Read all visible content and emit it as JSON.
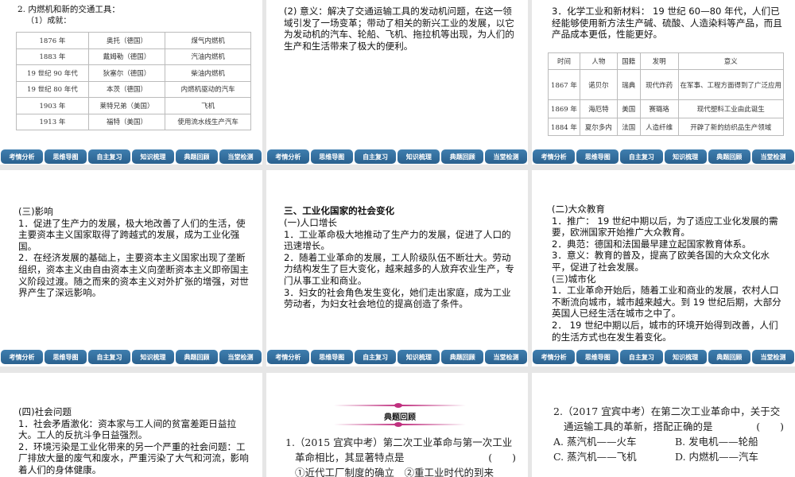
{
  "nav": [
    "考情分析",
    "思维导图",
    "自主复习",
    "知识梳理",
    "典题回顾",
    "当堂检测"
  ],
  "s1": {
    "title": "2. 内燃机和新的交通工具：",
    "sub": "（1）成就：",
    "rows": [
      [
        "1876 年",
        "奥托（德国）",
        "煤气内燃机"
      ],
      [
        "1883 年",
        "戴姆勒（德国）",
        "汽油内燃机"
      ],
      [
        "19 世纪 90 年代",
        "狄塞尔（德国）",
        "柴油内燃机"
      ],
      [
        "19 世纪 80 年代",
        "本茨（德国）",
        "内燃机驱动的汽车"
      ],
      [
        "1903 年",
        "莱特兄弟（美国）",
        "飞机"
      ],
      [
        "1913 年",
        "福特（美国）",
        "使用流水线生产汽车"
      ]
    ]
  },
  "s2": {
    "text": "(2) 意义：解决了交通运输工具的发动机问题，在这一领域引发了一场变革；带动了相关的新兴工业的发展，以它为发动机的汽车、轮船、飞机、拖拉机等出现，为人们的生产和生活带来了极大的便利。"
  },
  "s3": {
    "text": "3．化学工业和新材料： 19 世纪 60—80 年代，人们已经能够使用新方法生产碱、硫酸、人造染料等产品，而且产品成本更低，性能更好。",
    "header": [
      "时间",
      "人物",
      "国籍",
      "发明",
      "意义"
    ],
    "rows": [
      [
        "1867 年",
        "诺贝尔",
        "瑞典",
        "现代炸药",
        "在军事、工程方面得到了广泛应用"
      ],
      [
        "1869 年",
        "海厄特",
        "美国",
        "赛璐珞",
        "现代塑料工业由此诞生"
      ],
      [
        "1884 年",
        "夏尔多内",
        "法国",
        "人造纤维",
        "开辟了新的纺织品生产领域"
      ]
    ]
  },
  "s4": {
    "lines": [
      "(三)影响",
      "1．促进了生产力的发展，极大地改善了人们的生活，使主要资本主义国家取得了跨越式的发展，成为工业化强国。",
      "2．在经济发展的基础上，主要资本主义国家出现了垄断组织，资本主义由自由资本主义向垄断资本主义即帝国主义阶段过渡。随之而来的资本主义对外扩张的增强，对世界产生了深远影响。"
    ]
  },
  "s5": {
    "heading": "三、工业化国家的社会变化",
    "lines": [
      "(一)人口增长",
      "1．工业革命极大地推动了生产力的发展，促进了人口的迅速增长。",
      "2．随着工业革命的发展，工人阶级队伍不断壮大。劳动力结构发生了巨大变化，越来越多的人放弃农业生产，专门从事工业和商业。",
      "3．妇女的社会角色发生变化，她们走出家庭，成为工业劳动者，为妇女社会地位的提高创造了条件。"
    ]
  },
  "s6": {
    "lines": [
      "(二)大众教育",
      "1．推广： 19 世纪中期以后，为了适应工业化发展的需要，欧洲国家开始推广大众教育。",
      "2．典范：德国和法国最早建立起国家教育体系。",
      "3．意义：教育的普及，提高了欧美各国的大众文化水平，促进了社会发展。",
      "(三)城市化",
      "1．工业革命开始后，随着工业和商业的发展，农村人口不断流向城市，城市越来越大。到 19 世纪后期，大部分英国人已经生活在城市之中了。",
      "2． 19 世纪中期以后，城市的环境开始得到改善，人们的生活方式也在发生着变化。"
    ]
  },
  "s7": {
    "lines": [
      "(四)社会问题",
      "1．社会矛盾激化：资本家与工人间的贫富差距日益拉大。工人的反抗斗争日益强烈。",
      "2．环境污染是工业化带来的另一个严重的社会问题：工厂排放大量的废气和废水，严重污染了大气和河流，影响着人们的身体健康。"
    ]
  },
  "s8": {
    "banner": "典题回顾",
    "q1": "1.（2015 宜宾中考）第二次工业革命与第一次工业革命相比，其显著特点是",
    "paren": "(　　)",
    "opt": "①近代工厂制度的确立　②重工业时代的到来"
  },
  "s9": {
    "q": "2.（2017 宜宾中考）在第二次工业革命中，关于交通运输工具的革新，搭配正确的是",
    "paren": "(　　)",
    "a": "A. 蒸汽机——火车",
    "b": "B. 发电机——轮船",
    "c": "C. 蒸汽机——飞机",
    "d": "D. 内燃机——汽车"
  }
}
